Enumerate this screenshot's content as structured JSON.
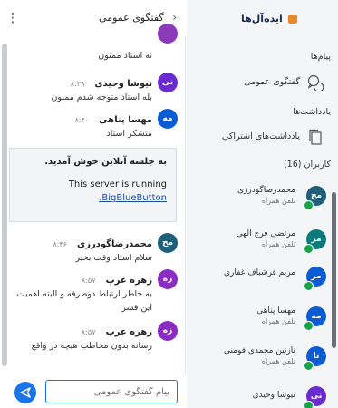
{
  "chat": {
    "header_title": "گفتگوی عمومی",
    "input_placeholder": "پیام گفتگوی عمومی",
    "messages": [
      {
        "text": "نه استاد ممنون",
        "avatar": "",
        "color": "#8a3ab9"
      },
      {
        "name": "نیوشا وحیدی",
        "time": "۸:۳۹",
        "text": "بله استاد متوجه شدم ممنون",
        "avatar": "نی",
        "color": "#6a2bd1"
      },
      {
        "name": "مهسا پناهی",
        "time": "۸:۴۰",
        "text": "متشکر استاد",
        "avatar": "مه",
        "color": "#0b5bd3"
      },
      {
        "name": "محمدرضاگودرزی",
        "time": "۸:۴۶",
        "text": "سلام استاد وقت بخیر",
        "avatar": "مح",
        "color": "#1f5f7a"
      },
      {
        "name": "زهره عرب",
        "time": "۸:۵۷",
        "text": "به خاطر ارتباط دوطرفه و البته اهمیت این قشر",
        "avatar": "زه",
        "color": "#8a2bc1"
      },
      {
        "name": "زهره عرب",
        "time": "۸:۵۷",
        "text": "رسانه بدون مخاطب هیچه در واقع",
        "avatar": "زه",
        "color": "#8a2bc1"
      }
    ],
    "welcome": {
      "title": "به جلسه آنلاین خوش آمدید.",
      "text": "This server is running",
      "link": "BigBlueButton."
    }
  },
  "sidebar": {
    "brand": "ایده‌آل‌ها",
    "messages_section": "پیام‌ها",
    "public_chat": "گفتگوی عمومی",
    "notes_section": "یادداشت‌ها",
    "shared_notes": "یادداشت‌های اشتراکی",
    "users_section": "کاربران (16)",
    "users": [
      {
        "name": "محمدرضاگودرزی",
        "status": "تلفن همراه",
        "avatar": "مح",
        "color": "#1f5f7a"
      },
      {
        "name": "مرتضی فرج الهی",
        "status": "تلفن همراه",
        "avatar": "مر",
        "color": "#0a7a7a"
      },
      {
        "name": "مریم فرشباف غفاری",
        "status": "",
        "avatar": "مر",
        "color": "#0b5bd3"
      },
      {
        "name": "مهسا پناهی",
        "status": "تلفن همراه",
        "avatar": "مه",
        "color": "#0b5bd3"
      },
      {
        "name": "نازنین محمدی فومنی",
        "status": "تلفن همراه",
        "avatar": "نا",
        "color": "#0b5bd3"
      },
      {
        "name": "نیوشا وحیدی",
        "status": "",
        "avatar": "نی",
        "color": "#6a2bd1"
      }
    ]
  }
}
